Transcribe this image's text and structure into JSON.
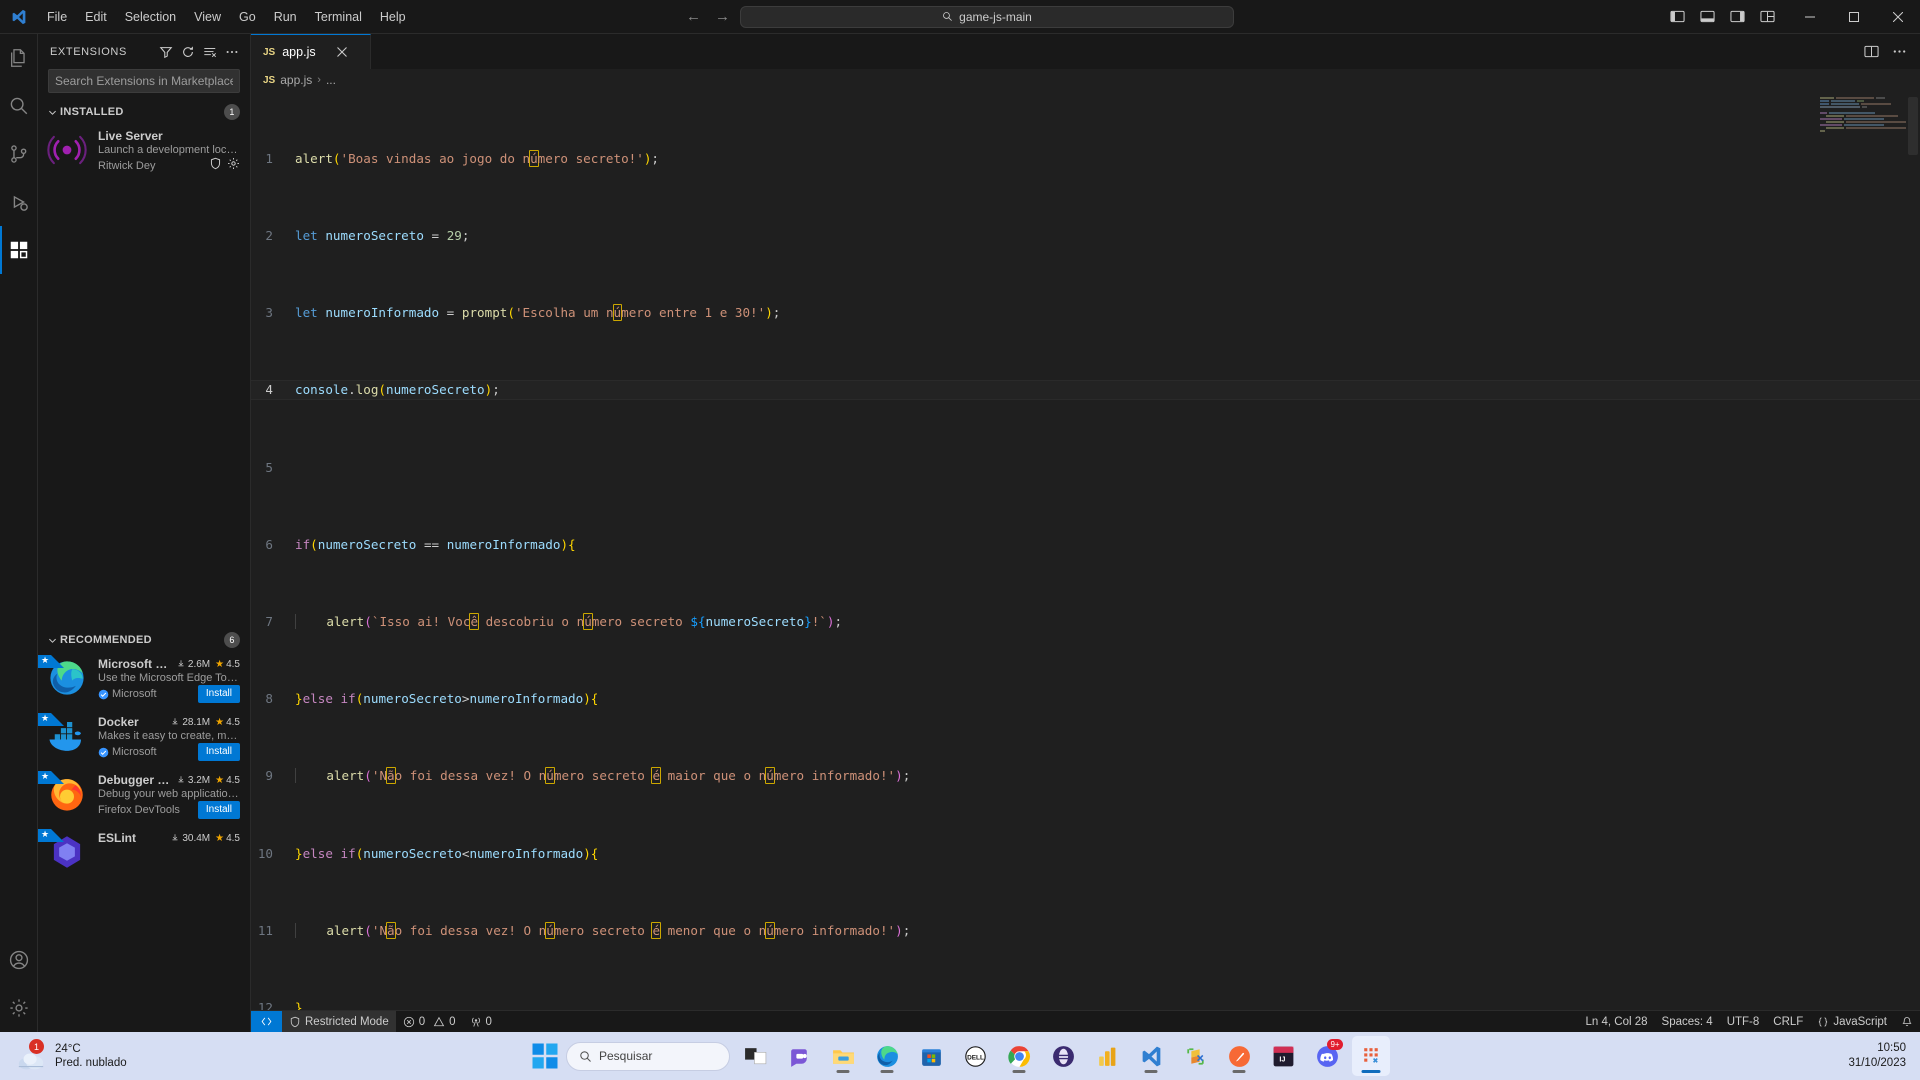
{
  "titlebar": {
    "menus": [
      "File",
      "Edit",
      "Selection",
      "View",
      "Go",
      "Run",
      "Terminal",
      "Help"
    ],
    "quick_input_value": "game-js-main",
    "back_arrow": "←",
    "forward_arrow": "→"
  },
  "activitybar": {
    "items": [
      {
        "name": "explorer",
        "icon": "files-icon"
      },
      {
        "name": "search",
        "icon": "search-icon"
      },
      {
        "name": "source-control",
        "icon": "source-control-icon"
      },
      {
        "name": "run-and-debug",
        "icon": "debug-icon"
      },
      {
        "name": "extensions",
        "icon": "extensions-icon"
      }
    ],
    "bottom": [
      {
        "name": "accounts",
        "icon": "account-icon"
      },
      {
        "name": "manage",
        "icon": "gear-icon"
      }
    ]
  },
  "sidebar": {
    "title": "EXTENSIONS",
    "actions": [
      "filter-icon",
      "refresh-icon",
      "clear-list-icon",
      "more-actions-icon"
    ],
    "search_placeholder": "Search Extensions in Marketplace",
    "search_value": "",
    "sections": [
      {
        "label": "INSTALLED",
        "count": "1",
        "extensions": [
          {
            "name": "Live Server",
            "description": "Launch a development local ...",
            "publisher": "Ritwick Dey",
            "verified": false,
            "installs": "",
            "rating": "",
            "action": "",
            "recommended": false,
            "icon": "live-server-icon"
          }
        ]
      },
      {
        "label": "RECOMMENDED",
        "count": "6",
        "extensions": [
          {
            "name": "Microsoft Ed...",
            "description": "Use the Microsoft Edge Tool...",
            "publisher": "Microsoft",
            "verified": true,
            "installs": "2.6M",
            "rating": "4.5",
            "action": "Install",
            "recommended": true,
            "icon": "edge-icon"
          },
          {
            "name": "Docker",
            "description": "Makes it easy to create, man...",
            "publisher": "Microsoft",
            "verified": true,
            "installs": "28.1M",
            "rating": "4.5",
            "action": "Install",
            "recommended": true,
            "icon": "docker-icon"
          },
          {
            "name": "Debugger for...",
            "description": "Debug your web application ...",
            "publisher": "Firefox DevTools",
            "verified": false,
            "installs": "3.2M",
            "rating": "4.5",
            "action": "Install",
            "recommended": true,
            "icon": "firefox-icon"
          },
          {
            "name": "ESLint",
            "description": "",
            "publisher": "",
            "verified": false,
            "installs": "30.4M",
            "rating": "4.5",
            "action": "",
            "recommended": true,
            "icon": "eslint-icon"
          }
        ]
      }
    ]
  },
  "editor": {
    "tab": {
      "label": "app.js",
      "badge": "JS"
    },
    "breadcrumb": {
      "badge": "JS",
      "file": "app.js",
      "sep": "›",
      "rest": "..."
    },
    "actions": [
      "split-editor-icon",
      "more-actions-icon"
    ],
    "lines": [
      {
        "n": "1",
        "text": "alert('Boas vindas ao jogo do número secreto!');"
      },
      {
        "n": "2",
        "text": "let numeroSecreto = 29;"
      },
      {
        "n": "3",
        "text": "let numeroInformado = prompt('Escolha um número entre 1 e 30!');"
      },
      {
        "n": "4",
        "text": "console.log(numeroSecreto);"
      },
      {
        "n": "5",
        "text": ""
      },
      {
        "n": "6",
        "text": "if(numeroSecreto == numeroInformado){"
      },
      {
        "n": "7",
        "text": "    alert(`Isso ai! Você descobriu o número secreto ${numeroSecreto}!`);"
      },
      {
        "n": "8",
        "text": "}else if(numeroSecreto>numeroInformado){"
      },
      {
        "n": "9",
        "text": "    alert('Não foi dessa vez! O número secreto é maior que o número informado!');"
      },
      {
        "n": "10",
        "text": "}else if(numeroSecreto<numeroInformado){"
      },
      {
        "n": "11",
        "text": "    alert('Não foi dessa vez! O número secreto é menor que o número informado!');"
      },
      {
        "n": "12",
        "text": "}"
      }
    ],
    "current_line": 4
  },
  "statusbar": {
    "remote_icon": "remote-window-icon",
    "restricted_mode": "Restricted Mode",
    "errors": "0",
    "warnings": "0",
    "ports": "0",
    "cursor": "Ln 4, Col 28",
    "indentation": "Spaces: 4",
    "encoding": "UTF-8",
    "eol": "CRLF",
    "language": "JavaScript",
    "bell_icon": "bell-icon"
  },
  "taskbar": {
    "weather": {
      "temp": "24°C",
      "description": "Pred. nublado",
      "badge": "1"
    },
    "search_placeholder": "Pesquisar",
    "apps": [
      {
        "name": "task-view",
        "badge": ""
      },
      {
        "name": "teams",
        "badge": ""
      },
      {
        "name": "file-explorer",
        "badge": ""
      },
      {
        "name": "edge",
        "badge": ""
      },
      {
        "name": "microsoft-store",
        "badge": ""
      },
      {
        "name": "dell",
        "badge": ""
      },
      {
        "name": "chrome",
        "badge": ""
      },
      {
        "name": "opera-gx",
        "badge": ""
      },
      {
        "name": "power-bi",
        "badge": ""
      },
      {
        "name": "vs-code",
        "badge": ""
      },
      {
        "name": "sublime-merge",
        "badge": ""
      },
      {
        "name": "postman",
        "badge": ""
      },
      {
        "name": "intellij-idea",
        "badge": ""
      },
      {
        "name": "discord",
        "badge": "9+"
      },
      {
        "name": "snipping-tool",
        "badge": ""
      }
    ],
    "clock": {
      "time": "10:50",
      "date": "31/10/2023"
    }
  },
  "colors": {
    "accent": "#0078d4",
    "editor_bg": "#1f1f1f",
    "chrome_bg": "#181818",
    "taskbar_bg": "#d6def3",
    "unicode_highlight": "#cca700"
  }
}
